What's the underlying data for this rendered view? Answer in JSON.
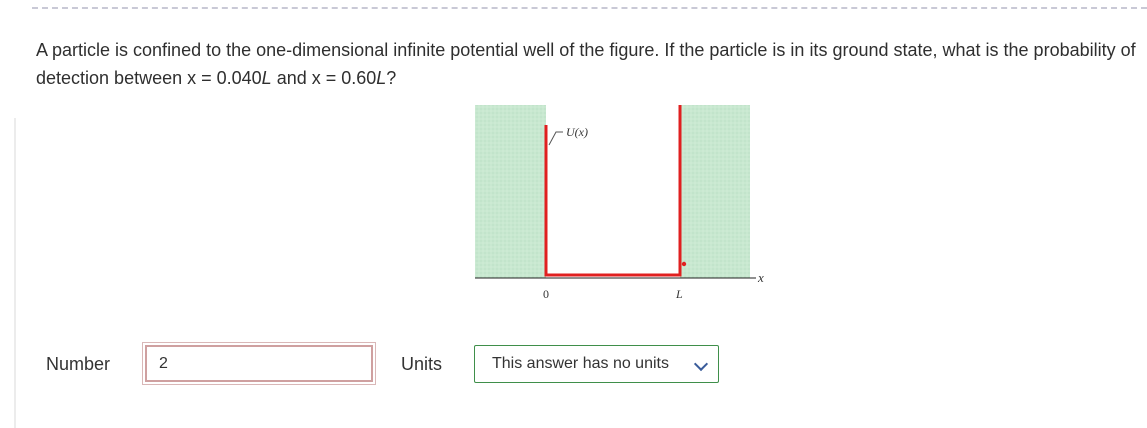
{
  "question": {
    "part1": "A particle is confined to the one-dimensional infinite potential well of the figure. If the particle is in its ground state, what is the probability of detection between x = 0.040",
    "L1": "L",
    "part2": " and x = 0.60",
    "L2": "L",
    "part3": "?"
  },
  "figure": {
    "potential_label": "U(x)",
    "x_axis_label": "x",
    "origin_tick": "0",
    "width_tick": "L",
    "region_fill": "#c8e8d0",
    "wall_color": "#e02020"
  },
  "answer": {
    "number_label": "Number",
    "number_value": "2",
    "units_label": "Units",
    "units_selected": "This answer has no units"
  }
}
